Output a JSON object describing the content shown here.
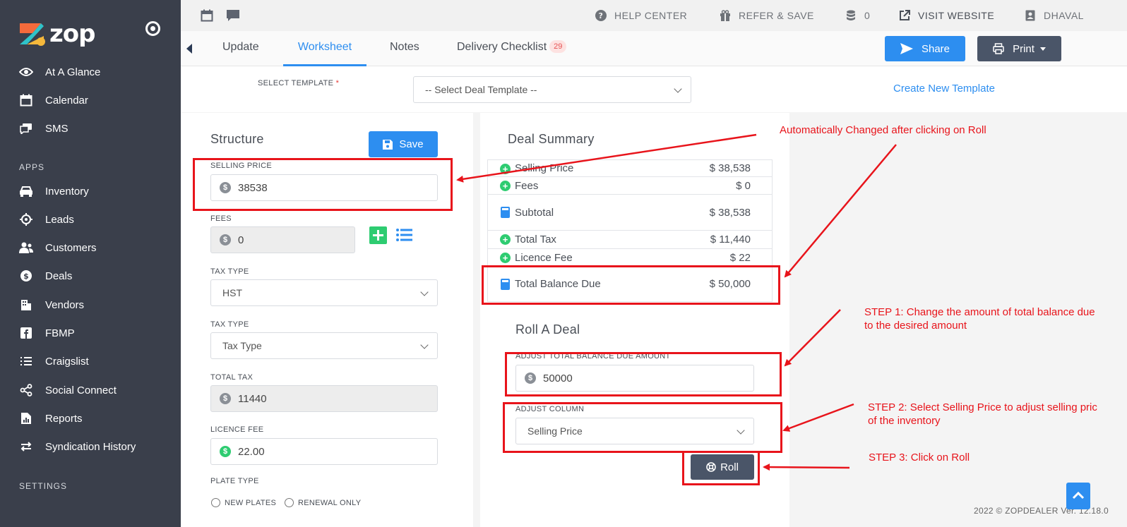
{
  "sidebar": {
    "brand": "zop",
    "items_top": [
      {
        "label": "At A Glance",
        "icon": "eye-icon"
      },
      {
        "label": "Calendar",
        "icon": "calendar-icon"
      },
      {
        "label": "SMS",
        "icon": "chat-icon"
      }
    ],
    "apps_label": "APPS",
    "apps": [
      {
        "label": "Inventory",
        "icon": "car-icon"
      },
      {
        "label": "Leads",
        "icon": "crosshair-icon"
      },
      {
        "label": "Customers",
        "icon": "users-icon"
      },
      {
        "label": "Deals",
        "icon": "dollar-icon"
      },
      {
        "label": "Vendors",
        "icon": "building-icon"
      },
      {
        "label": "FBMP",
        "icon": "facebook-icon"
      },
      {
        "label": "Craigslist",
        "icon": "list-icon"
      },
      {
        "label": "Social Connect",
        "icon": "share-icon"
      },
      {
        "label": "Reports",
        "icon": "report-icon"
      },
      {
        "label": "Syndication History",
        "icon": "swap-icon"
      }
    ],
    "settings_label": "SETTINGS"
  },
  "topbar": {
    "help": "HELP CENTER",
    "refer": "REFER & SAVE",
    "credits": "0",
    "visit": "VISIT WEBSITE",
    "user": "DHAVAL"
  },
  "tabs": [
    {
      "label": "Update"
    },
    {
      "label": "Worksheet"
    },
    {
      "label": "Notes"
    },
    {
      "label": "Delivery Checklist",
      "badge": "29"
    }
  ],
  "actions": {
    "share": "Share",
    "print": "Print"
  },
  "template": {
    "label": "SELECT TEMPLATE",
    "required": "*",
    "value": "-- Select Deal Template --",
    "create_link": "Create New Template"
  },
  "structure": {
    "title": "Structure",
    "save": "Save",
    "selling_price_label": "SELLING PRICE",
    "selling_price": "38538",
    "fees_label": "FEES",
    "fees": "0",
    "tax_type_label_1": "TAX TYPE",
    "tax_type_1": "HST",
    "tax_type_label_2": "TAX TYPE",
    "tax_type_2": "Tax Type",
    "total_tax_label": "TOTAL TAX",
    "total_tax": "11440",
    "licence_fee_label": "LICENCE FEE",
    "licence_fee": "22.00",
    "plate_type_label": "PLATE TYPE",
    "plate_new": "NEW PLATES",
    "plate_renewal": "RENEWAL ONLY"
  },
  "summary": {
    "title": "Deal Summary",
    "rows": [
      {
        "label": "Selling Price",
        "value": "$ 38,538"
      },
      {
        "label": "Fees",
        "value": "$ 0"
      },
      {
        "label": "Subtotal",
        "value": "$ 38,538"
      },
      {
        "label": "Total Tax",
        "value": "$ 11,440"
      },
      {
        "label": "Licence Fee",
        "value": "$ 22"
      },
      {
        "label": "Total Balance Due",
        "value": "$ 50,000"
      }
    ]
  },
  "roll": {
    "title": "Roll A Deal",
    "adjust_total_label": "ADJUST TOTAL BALANCE DUE AMOUNT",
    "adjust_total": "50000",
    "adjust_column_label": "ADJUST COLUMN",
    "adjust_column": "Selling Price",
    "button": "Roll"
  },
  "annotations": {
    "auto": "Automatically Changed after clicking on Roll",
    "step1_line1": "STEP 1: Change the amount of total balance due",
    "step1_line2": "to the desired amount",
    "step2_line1": "STEP 2: Select Selling Price to adjust selling pric",
    "step2_line2": "of the inventory",
    "step3": "STEP 3: Click on Roll"
  },
  "footer": "2022 © ZOPDEALER Ver. 12.18.0",
  "colors": {
    "accent": "#2d8ef0",
    "sidebar": "#3a3f4b",
    "annotation": "#e8141b",
    "plus": "#2ecc71"
  }
}
